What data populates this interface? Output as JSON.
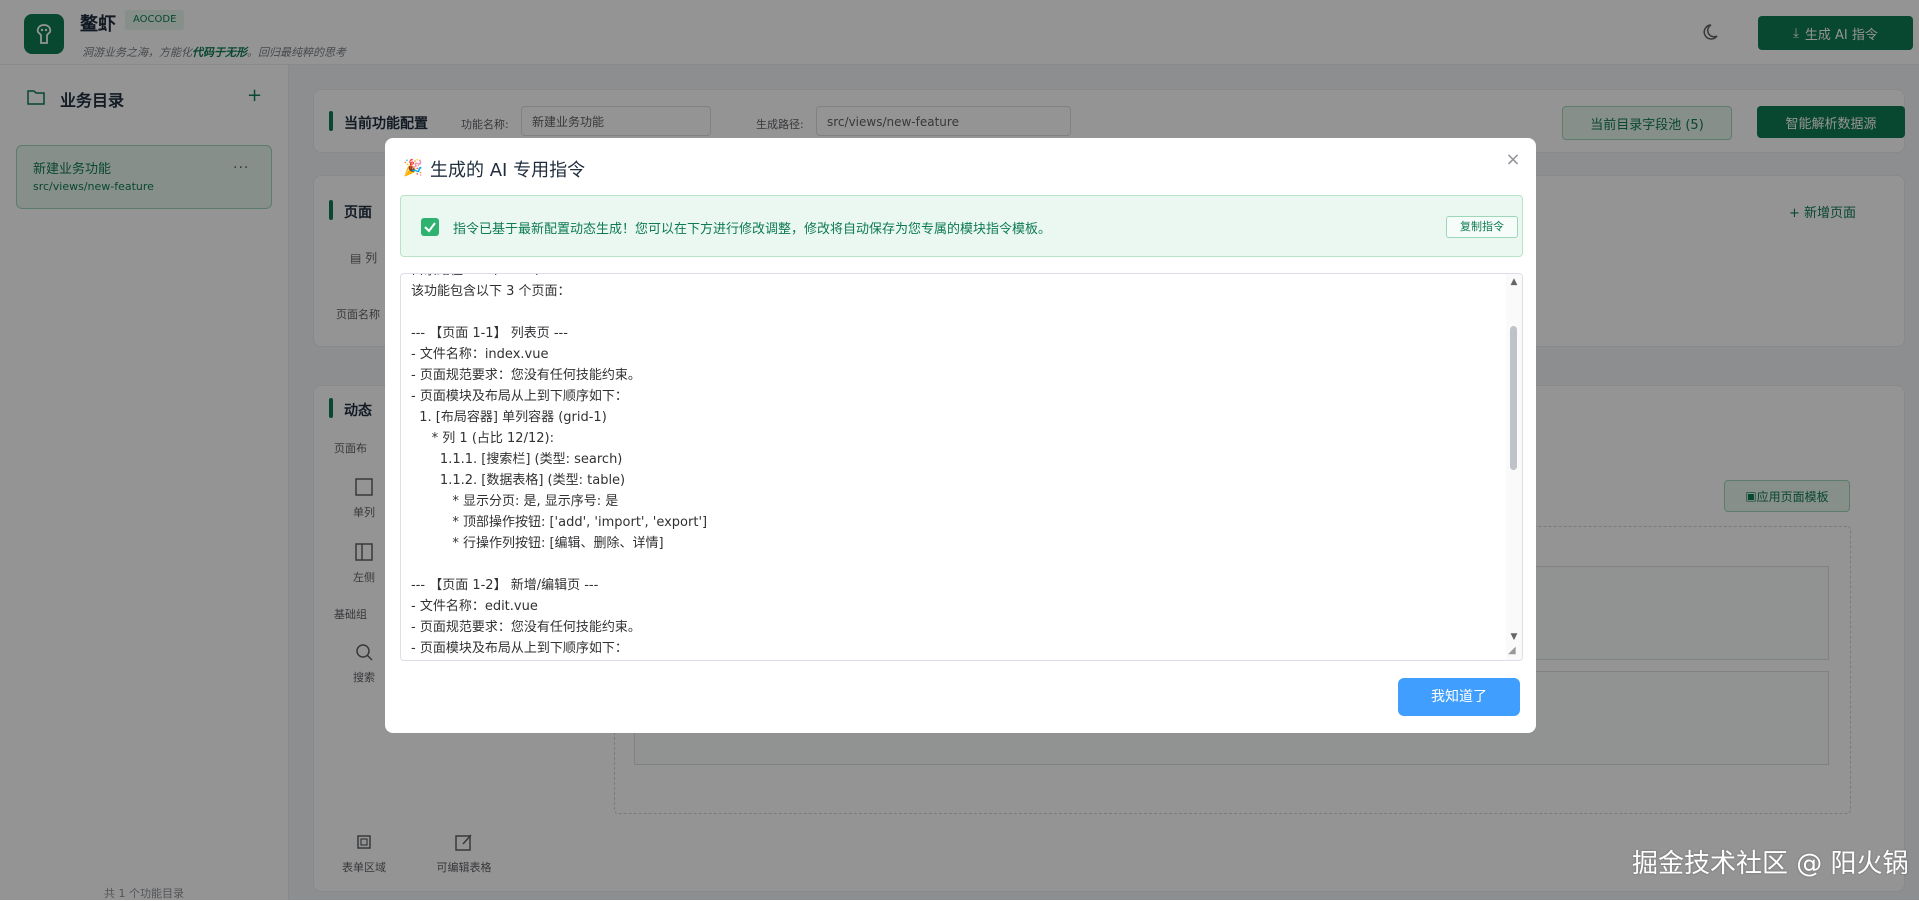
{
  "header": {
    "brand": "鳌虾",
    "badge": "AOCODE",
    "slogan_pre": "洞游业务之海，方能化",
    "slogan_em": "代码于无形",
    "slogan_post": "。回归最纯粹的思考",
    "generate_btn": "生成 AI 指令"
  },
  "sidebar": {
    "title": "业务目录",
    "item_name": "新建业务功能",
    "item_path": "src/views/new-feature",
    "footer": "共 1 个功能目录"
  },
  "main": {
    "config_title": "当前功能配置",
    "name_label": "功能名称:",
    "name_value": "新建业务功能",
    "path_label": "生成路径:",
    "path_value": "src/views/new-feature",
    "pool_btn": "当前目录字段池 (5)",
    "parse_btn": "智能解析数据源",
    "page_section_title": "页面",
    "page_tab": "列",
    "page_name_label": "页面名称",
    "add_page": "新增页面",
    "dynamic_title": "动态",
    "layout_label": "页面布",
    "base_label": "基础组",
    "apply_template": "应用页面模板",
    "tools": [
      {
        "label": "单列",
        "icon": "single-column-icon"
      },
      {
        "label": "左侧",
        "icon": "left-layout-icon"
      },
      {
        "label": "搜索",
        "icon": "search-icon"
      },
      {
        "label": "表单区域",
        "icon": "form-area-icon"
      },
      {
        "label": "可编辑表格",
        "icon": "editable-table-icon"
      }
    ]
  },
  "modal": {
    "title": "生成的 AI 专用指令",
    "alert_text": "指令已基于最新配置动态生成！您可以在下方进行修改调整，修改将自动保存为您专属的模块指令模板。",
    "copy_btn": "复制指令",
    "lines": [
      "目录路径：src/views/new-feature",
      "该功能包含以下 3 个页面：",
      "",
      "--- 【页面 1-1】 列表页 ---",
      "- 文件名称：index.vue",
      "- 页面规范要求：您没有任何技能约束。",
      "- 页面模块及布局从上到下顺序如下：",
      "  1. [布局容器] 单列容器 (grid-1)",
      "     * 列 1 (占比 12/12):",
      "       1.1.1. [搜索栏] (类型: search)",
      "       1.1.2. [数据表格] (类型: table)",
      "          * 显示分页: 是, 显示序号: 是",
      "          * 顶部操作按钮: ['add', 'import', 'export']",
      "          * 行操作列按钮: [编辑、删除、详情]",
      "",
      "--- 【页面 1-2】 新增/编辑页 ---",
      "- 文件名称：edit.vue",
      "- 页面规范要求：您没有任何技能约束。",
      "- 页面模块及布局从上到下顺序如下："
    ],
    "ok_btn": "我知道了"
  },
  "watermark": "掘金技术社区 @ 阳火锅"
}
